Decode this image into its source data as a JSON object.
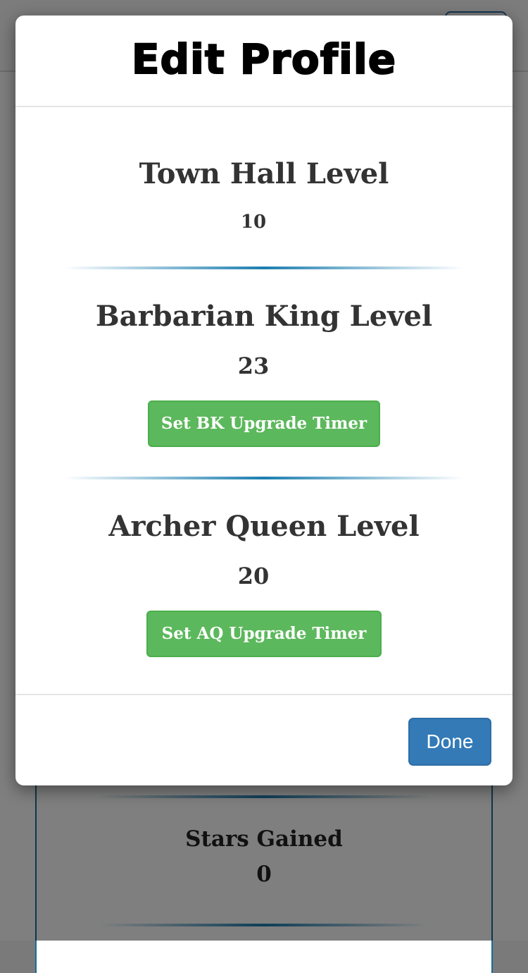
{
  "background": {
    "stats_label": "Stars Gained",
    "stats_value": "0"
  },
  "modal": {
    "title": "Edit Profile",
    "sections": [
      {
        "heading": "Town Hall Level",
        "value": "10"
      },
      {
        "heading": "Barbarian King Level",
        "value": "23",
        "button": "Set BK Upgrade Timer"
      },
      {
        "heading": "Archer Queen Level",
        "value": "20",
        "button": "Set AQ Upgrade Timer"
      }
    ],
    "done_label": "Done"
  },
  "colors": {
    "success_button": "#5cb85c",
    "primary_button": "#337ab7",
    "divider_accent": "#1c7eb0"
  }
}
